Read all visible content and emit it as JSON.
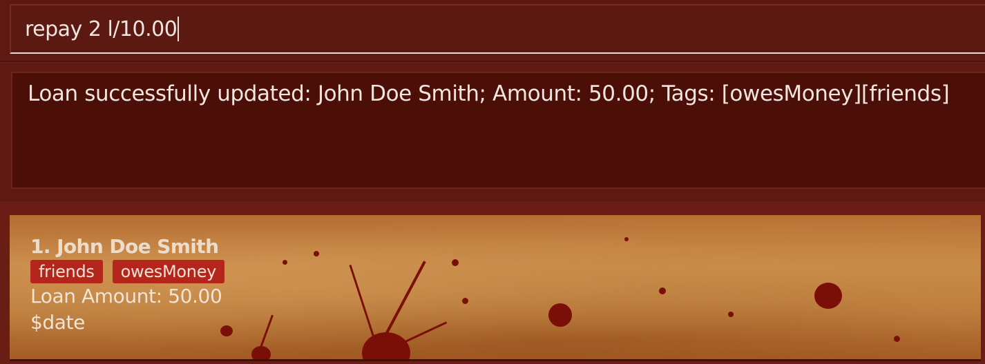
{
  "command": {
    "input_value": "repay 2 l/10.00"
  },
  "result": {
    "message": "Loan successfully updated: John Doe Smith; Amount: 50.00; Tags: [owesMoney][friends]"
  },
  "loan_list": {
    "items": [
      {
        "title": "1. John Doe Smith",
        "tags": [
          "friends",
          "owesMoney"
        ],
        "loan_amount": "Loan Amount: 50.00",
        "date": "$date"
      }
    ]
  },
  "colors": {
    "background": "#6a1d14",
    "result_background": "#4b0f08",
    "tag": "#b4261c",
    "text": "#f1e6df"
  }
}
